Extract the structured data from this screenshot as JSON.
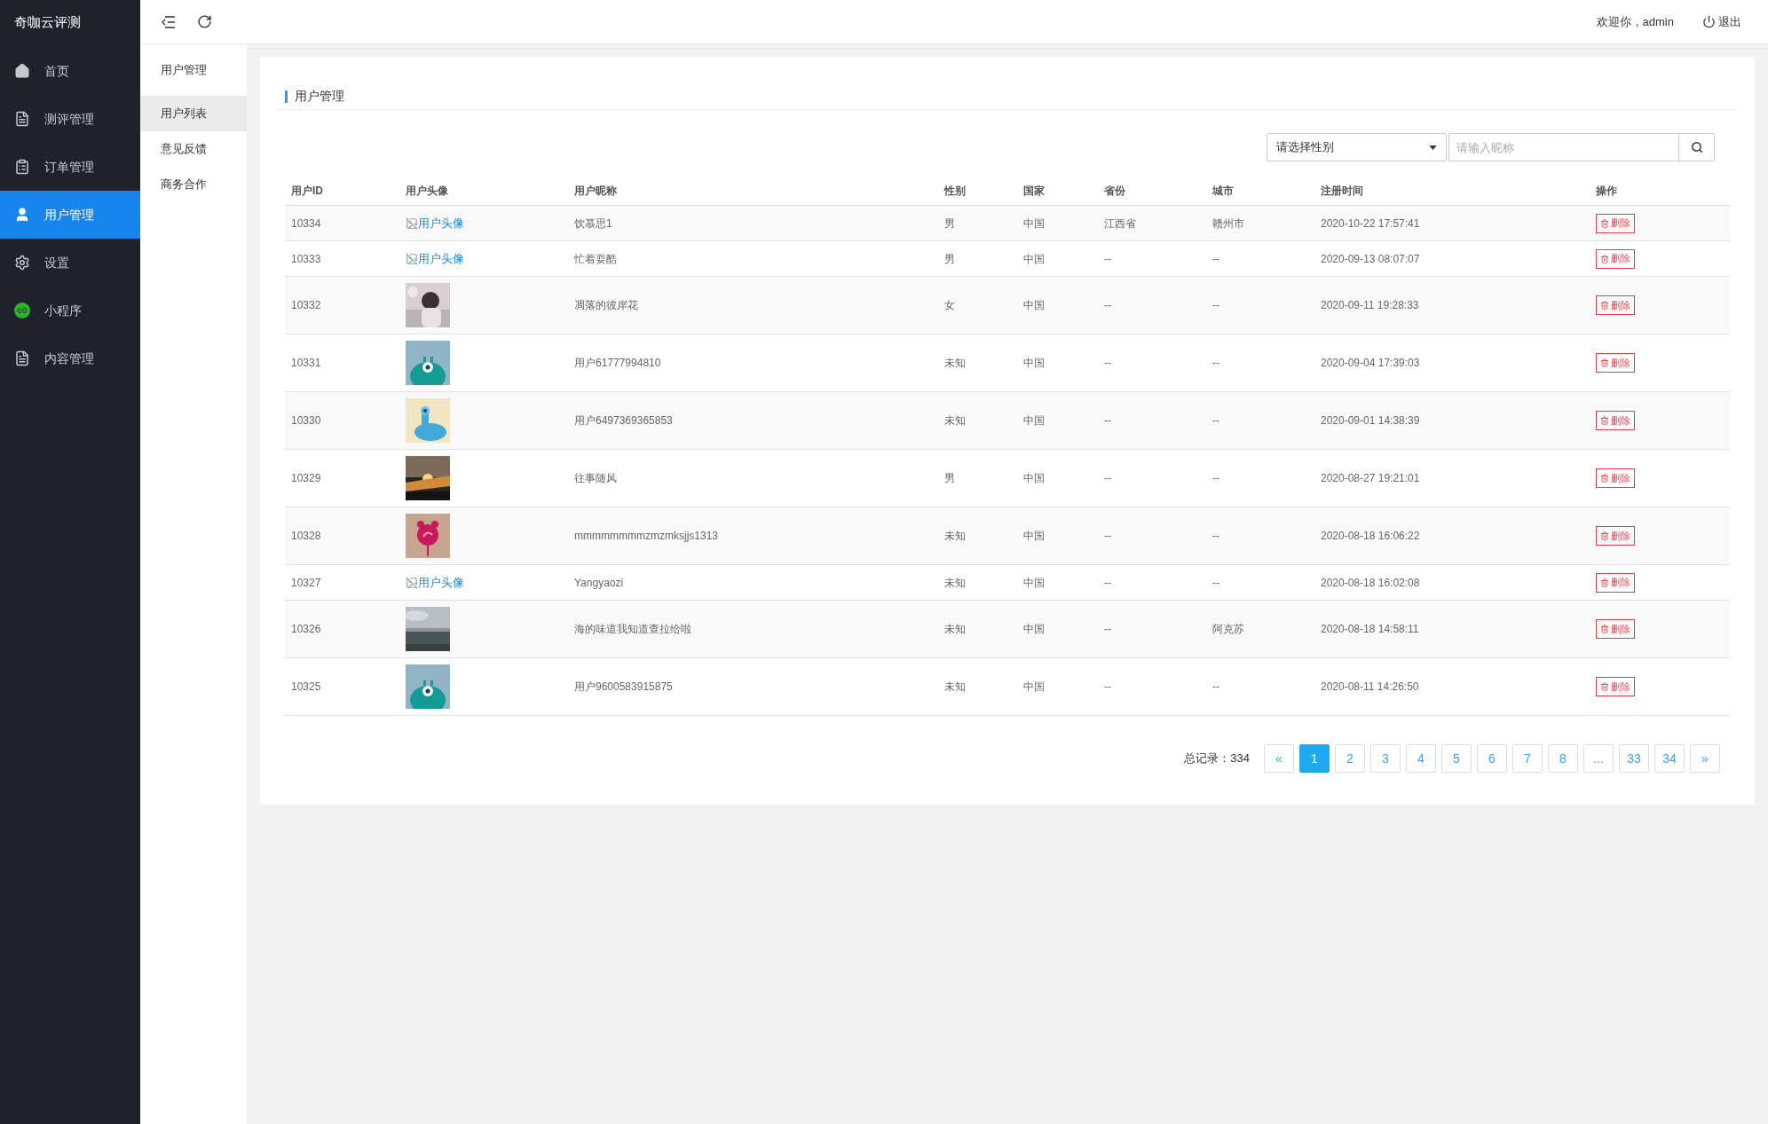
{
  "sidebar": {
    "logo": "奇咖云评测",
    "items": [
      {
        "label": "首页",
        "selected": false
      },
      {
        "label": "测评管理",
        "selected": false
      },
      {
        "label": "订单管理",
        "selected": false
      },
      {
        "label": "用户管理",
        "selected": true
      },
      {
        "label": "设置",
        "selected": false
      },
      {
        "label": "小程序",
        "selected": false
      },
      {
        "label": "内容管理",
        "selected": false
      }
    ]
  },
  "subnav": {
    "title": "用户管理",
    "items": [
      {
        "label": "用户列表",
        "selected": true
      },
      {
        "label": "意见反馈",
        "selected": false
      },
      {
        "label": "商务合作",
        "selected": false
      }
    ]
  },
  "header": {
    "welcome": "欢迎你，admin",
    "logout": "退出"
  },
  "card": {
    "title": "用户管理",
    "gender_select": "请选择性别",
    "search": {
      "placeholder": "请输入昵称"
    }
  },
  "table": {
    "columns": [
      "用户ID",
      "用户头像",
      "用户昵称",
      "性别",
      "国家",
      "省份",
      "城市",
      "注册时间",
      "操作"
    ],
    "rows": [
      {
        "id": "10334",
        "avatar": {
          "kind": "broken",
          "alt": "用户头像"
        },
        "nickname": "饮慕思1",
        "gender": "男",
        "country": "中国",
        "province": "江西省",
        "city": "赣州市",
        "time": "2020-10-22 17:57:41",
        "action": "删除"
      },
      {
        "id": "10333",
        "avatar": {
          "kind": "broken",
          "alt": "用户头像"
        },
        "nickname": "忙着耍酷",
        "gender": "男",
        "country": "中国",
        "province": "--",
        "city": "--",
        "time": "2020-09-13 08:07:07",
        "action": "删除"
      },
      {
        "id": "10332",
        "nickname": "凋落的彼岸花",
        "gender": "女",
        "country": "中国",
        "province": "--",
        "city": "--",
        "time": "2020-09-11 19:28:33",
        "action": "删除"
      },
      {
        "id": "10331",
        "nickname": "用户61777994810",
        "gender": "未知",
        "country": "中国",
        "province": "--",
        "city": "--",
        "time": "2020-09-04 17:39:03",
        "action": "删除"
      },
      {
        "id": "10330",
        "nickname": "用户6497369365853",
        "gender": "未知",
        "country": "中国",
        "province": "--",
        "city": "--",
        "time": "2020-09-01 14:38:39",
        "action": "删除"
      },
      {
        "id": "10329",
        "nickname": "往事随风",
        "gender": "男",
        "country": "中国",
        "province": "--",
        "city": "--",
        "time": "2020-08-27 19:21:01",
        "action": "删除"
      },
      {
        "id": "10328",
        "nickname": "mmmmmmmmzmzmksjjs1313",
        "gender": "未知",
        "country": "中国",
        "province": "--",
        "city": "--",
        "time": "2020-08-18 16:06:22",
        "action": "删除"
      },
      {
        "id": "10327",
        "avatar": {
          "kind": "broken",
          "alt": "用户头像"
        },
        "nickname": "Yangyaozi",
        "gender": "未知",
        "country": "中国",
        "province": "--",
        "city": "--",
        "time": "2020-08-18 16:02:08",
        "action": "删除"
      },
      {
        "id": "10326",
        "nickname": "海的味道我知道查拉给啦",
        "gender": "未知",
        "country": "中国",
        "province": "--",
        "city": "阿克苏",
        "time": "2020-08-18 14:58:11",
        "action": "删除"
      },
      {
        "id": "10325",
        "nickname": "用户9600583915875",
        "gender": "未知",
        "country": "中国",
        "province": "--",
        "city": "--",
        "time": "2020-08-11 14:26:50",
        "action": "删除"
      }
    ]
  },
  "pagination": {
    "total": "总记录：334",
    "pages": [
      {
        "label": "«",
        "selected": false
      },
      {
        "label": "1",
        "selected": true
      },
      {
        "label": "2",
        "selected": false
      },
      {
        "label": "3",
        "selected": false
      },
      {
        "label": "4",
        "selected": false
      },
      {
        "label": "5",
        "selected": false
      },
      {
        "label": "6",
        "selected": false
      },
      {
        "label": "7",
        "selected": false
      },
      {
        "label": "8",
        "selected": false
      },
      {
        "label": "...",
        "selected": false
      },
      {
        "label": "33",
        "selected": false
      },
      {
        "label": "34",
        "selected": false
      },
      {
        "label": "»",
        "selected": false
      }
    ]
  }
}
